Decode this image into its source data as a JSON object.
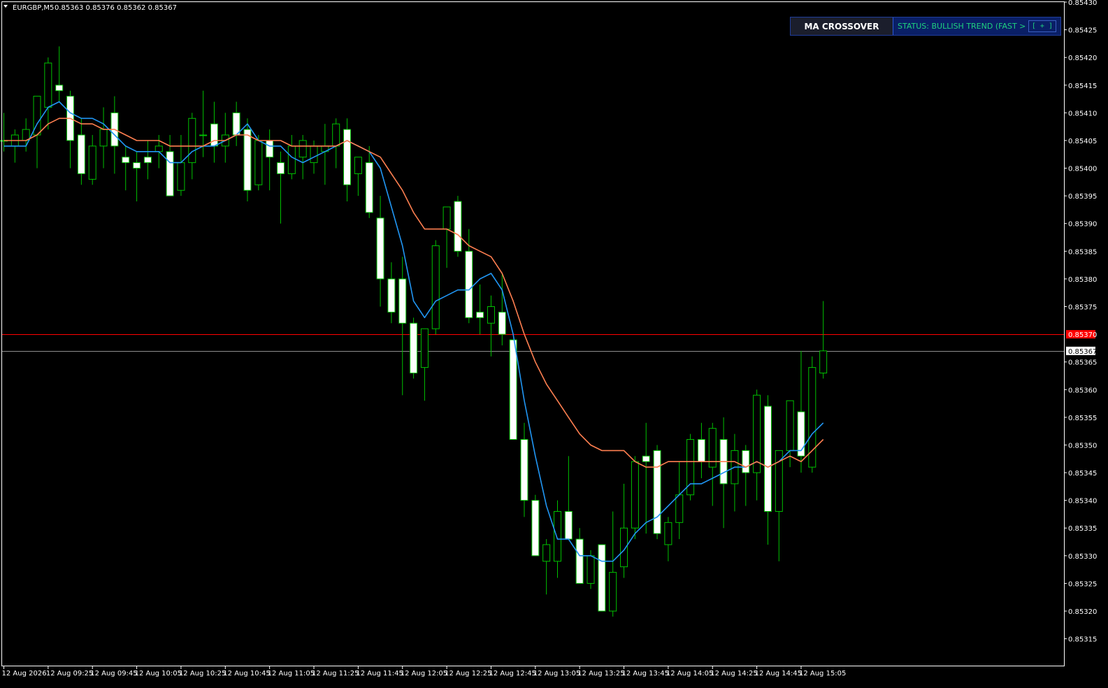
{
  "header": {
    "symbol": "EURGBP,M5",
    "ohlc": "0.85363 0.85376 0.85362 0.85367"
  },
  "panel": {
    "title": "MA CROSSOVER",
    "status": "STATUS: BULLISH TREND (FAST > SLOW)",
    "expand_label": "[ + ]"
  },
  "colors": {
    "background": "#000000",
    "candle_outline": "#00c000",
    "bull_body": "#000000",
    "bear_body": "#ffffff",
    "fast_ma": "#2196f3",
    "slow_ma": "#ff7f50",
    "alert_line": "#ff0000",
    "bid_line": "#8c8c8c",
    "price_scale_text": "#ffffff"
  },
  "chart_data": {
    "type": "candlestick",
    "symbol": "EURGBP",
    "timeframe": "M5",
    "ylim": [
      0.85312,
      0.8543
    ],
    "yticks": [
      "0.85430",
      "0.85425",
      "0.85420",
      "0.85415",
      "0.85410",
      "0.85405",
      "0.85400",
      "0.85395",
      "0.85390",
      "0.85385",
      "0.85380",
      "0.85375",
      "0.85365",
      "0.85360",
      "0.85355",
      "0.85350",
      "0.85345",
      "0.85340",
      "0.85335",
      "0.85330",
      "0.85325",
      "0.85320",
      "0.85315"
    ],
    "xticks": [
      {
        "index": 0,
        "label": "12 Aug 2026"
      },
      {
        "index": 4,
        "label": "12 Aug 09:25"
      },
      {
        "index": 8,
        "label": "12 Aug 09:45"
      },
      {
        "index": 12,
        "label": "12 Aug 10:05"
      },
      {
        "index": 16,
        "label": "12 Aug 10:25"
      },
      {
        "index": 20,
        "label": "12 Aug 10:45"
      },
      {
        "index": 24,
        "label": "12 Aug 11:05"
      },
      {
        "index": 28,
        "label": "12 Aug 11:25"
      },
      {
        "index": 32,
        "label": "12 Aug 11:45"
      },
      {
        "index": 36,
        "label": "12 Aug 12:05"
      },
      {
        "index": 40,
        "label": "12 Aug 12:25"
      },
      {
        "index": 44,
        "label": "12 Aug 12:45"
      },
      {
        "index": 48,
        "label": "12 Aug 13:05"
      },
      {
        "index": 52,
        "label": "12 Aug 13:25"
      },
      {
        "index": 56,
        "label": "12 Aug 13:45"
      },
      {
        "index": 60,
        "label": "12 Aug 14:05"
      },
      {
        "index": 64,
        "label": "12 Aug 14:25"
      },
      {
        "index": 68,
        "label": "12 Aug 14:45"
      },
      {
        "index": 72,
        "label": "12 Aug 15:05"
      }
    ],
    "candles": [
      {
        "o": 0.85405,
        "h": 0.8541,
        "l": 0.85403,
        "c": 0.85405
      },
      {
        "o": 0.85404,
        "h": 0.85407,
        "l": 0.85401,
        "c": 0.85406
      },
      {
        "o": 0.85405,
        "h": 0.85409,
        "l": 0.85403,
        "c": 0.85407
      },
      {
        "o": 0.85406,
        "h": 0.85413,
        "l": 0.854,
        "c": 0.85413
      },
      {
        "o": 0.85411,
        "h": 0.8542,
        "l": 0.85407,
        "c": 0.85419
      },
      {
        "o": 0.85415,
        "h": 0.85422,
        "l": 0.85412,
        "c": 0.85414
      },
      {
        "o": 0.85413,
        "h": 0.85414,
        "l": 0.854,
        "c": 0.85405
      },
      {
        "o": 0.85406,
        "h": 0.85409,
        "l": 0.85397,
        "c": 0.85399
      },
      {
        "o": 0.85398,
        "h": 0.85406,
        "l": 0.85397,
        "c": 0.85404
      },
      {
        "o": 0.85404,
        "h": 0.85411,
        "l": 0.854,
        "c": 0.85407
      },
      {
        "o": 0.8541,
        "h": 0.85413,
        "l": 0.85399,
        "c": 0.85404
      },
      {
        "o": 0.85402,
        "h": 0.85404,
        "l": 0.85396,
        "c": 0.85401
      },
      {
        "o": 0.85401,
        "h": 0.85403,
        "l": 0.85394,
        "c": 0.854
      },
      {
        "o": 0.85402,
        "h": 0.85405,
        "l": 0.85398,
        "c": 0.85401
      },
      {
        "o": 0.85403,
        "h": 0.85406,
        "l": 0.854,
        "c": 0.85404
      },
      {
        "o": 0.85403,
        "h": 0.85406,
        "l": 0.85395,
        "c": 0.85395
      },
      {
        "o": 0.85396,
        "h": 0.85406,
        "l": 0.85395,
        "c": 0.85401
      },
      {
        "o": 0.85401,
        "h": 0.8541,
        "l": 0.85398,
        "c": 0.85409
      },
      {
        "o": 0.85406,
        "h": 0.85414,
        "l": 0.85402,
        "c": 0.85406
      },
      {
        "o": 0.85408,
        "h": 0.85412,
        "l": 0.85401,
        "c": 0.85404
      },
      {
        "o": 0.85404,
        "h": 0.8541,
        "l": 0.85401,
        "c": 0.85406
      },
      {
        "o": 0.8541,
        "h": 0.85412,
        "l": 0.85404,
        "c": 0.85406
      },
      {
        "o": 0.85407,
        "h": 0.85409,
        "l": 0.85394,
        "c": 0.85396
      },
      {
        "o": 0.85397,
        "h": 0.85406,
        "l": 0.85396,
        "c": 0.85405
      },
      {
        "o": 0.85405,
        "h": 0.85407,
        "l": 0.85396,
        "c": 0.85402
      },
      {
        "o": 0.85401,
        "h": 0.85403,
        "l": 0.8539,
        "c": 0.85399
      },
      {
        "o": 0.85399,
        "h": 0.85406,
        "l": 0.85398,
        "c": 0.85404
      },
      {
        "o": 0.85402,
        "h": 0.85406,
        "l": 0.85398,
        "c": 0.85405
      },
      {
        "o": 0.85401,
        "h": 0.85405,
        "l": 0.85399,
        "c": 0.85404
      },
      {
        "o": 0.85403,
        "h": 0.85408,
        "l": 0.85397,
        "c": 0.85404
      },
      {
        "o": 0.85404,
        "h": 0.85409,
        "l": 0.854,
        "c": 0.85408
      },
      {
        "o": 0.85407,
        "h": 0.85409,
        "l": 0.85394,
        "c": 0.85397
      },
      {
        "o": 0.85399,
        "h": 0.85402,
        "l": 0.85395,
        "c": 0.85402
      },
      {
        "o": 0.85401,
        "h": 0.85404,
        "l": 0.85391,
        "c": 0.85392
      },
      {
        "o": 0.85391,
        "h": 0.85395,
        "l": 0.85375,
        "c": 0.8538
      },
      {
        "o": 0.8538,
        "h": 0.85383,
        "l": 0.85372,
        "c": 0.85374
      },
      {
        "o": 0.8538,
        "h": 0.85384,
        "l": 0.85359,
        "c": 0.85372
      },
      {
        "o": 0.85372,
        "h": 0.85373,
        "l": 0.85362,
        "c": 0.85363
      },
      {
        "o": 0.85364,
        "h": 0.85371,
        "l": 0.85358,
        "c": 0.85371
      },
      {
        "o": 0.85371,
        "h": 0.85387,
        "l": 0.8537,
        "c": 0.85386
      },
      {
        "o": 0.85389,
        "h": 0.85393,
        "l": 0.85382,
        "c": 0.85393
      },
      {
        "o": 0.85394,
        "h": 0.85395,
        "l": 0.85384,
        "c": 0.85385
      },
      {
        "o": 0.85385,
        "h": 0.85389,
        "l": 0.85372,
        "c": 0.85373
      },
      {
        "o": 0.85374,
        "h": 0.85379,
        "l": 0.8537,
        "c": 0.85373
      },
      {
        "o": 0.85372,
        "h": 0.85377,
        "l": 0.85366,
        "c": 0.85375
      },
      {
        "o": 0.85374,
        "h": 0.85381,
        "l": 0.85368,
        "c": 0.8537
      },
      {
        "o": 0.85369,
        "h": 0.85369,
        "l": 0.85351,
        "c": 0.85351
      },
      {
        "o": 0.85351,
        "h": 0.85354,
        "l": 0.85337,
        "c": 0.8534
      },
      {
        "o": 0.8534,
        "h": 0.85341,
        "l": 0.8533,
        "c": 0.8533
      },
      {
        "o": 0.85329,
        "h": 0.85333,
        "l": 0.85323,
        "c": 0.85332
      },
      {
        "o": 0.85329,
        "h": 0.8534,
        "l": 0.85326,
        "c": 0.85338
      },
      {
        "o": 0.85338,
        "h": 0.85348,
        "l": 0.85333,
        "c": 0.85333
      },
      {
        "o": 0.85333,
        "h": 0.85335,
        "l": 0.85325,
        "c": 0.85325
      },
      {
        "o": 0.85325,
        "h": 0.85331,
        "l": 0.85324,
        "c": 0.8533
      },
      {
        "o": 0.85332,
        "h": 0.85332,
        "l": 0.8532,
        "c": 0.8532
      },
      {
        "o": 0.8532,
        "h": 0.85338,
        "l": 0.85319,
        "c": 0.85327
      },
      {
        "o": 0.85328,
        "h": 0.85343,
        "l": 0.85326,
        "c": 0.85335
      },
      {
        "o": 0.85335,
        "h": 0.85348,
        "l": 0.85333,
        "c": 0.85347
      },
      {
        "o": 0.85348,
        "h": 0.85354,
        "l": 0.85334,
        "c": 0.85347
      },
      {
        "o": 0.85349,
        "h": 0.8535,
        "l": 0.85333,
        "c": 0.85334
      },
      {
        "o": 0.85332,
        "h": 0.85337,
        "l": 0.85329,
        "c": 0.85336
      },
      {
        "o": 0.85336,
        "h": 0.85347,
        "l": 0.85333,
        "c": 0.85341
      },
      {
        "o": 0.85341,
        "h": 0.85352,
        "l": 0.8534,
        "c": 0.85351
      },
      {
        "o": 0.85351,
        "h": 0.85354,
        "l": 0.85344,
        "c": 0.85347
      },
      {
        "o": 0.85346,
        "h": 0.85354,
        "l": 0.85339,
        "c": 0.85353
      },
      {
        "o": 0.85351,
        "h": 0.85355,
        "l": 0.85335,
        "c": 0.85343
      },
      {
        "o": 0.85343,
        "h": 0.85352,
        "l": 0.85338,
        "c": 0.85349
      },
      {
        "o": 0.85349,
        "h": 0.8535,
        "l": 0.85339,
        "c": 0.85345
      },
      {
        "o": 0.85345,
        "h": 0.8536,
        "l": 0.8534,
        "c": 0.85359
      },
      {
        "o": 0.85357,
        "h": 0.85359,
        "l": 0.85332,
        "c": 0.85338
      },
      {
        "o": 0.85338,
        "h": 0.85348,
        "l": 0.85329,
        "c": 0.85349
      },
      {
        "o": 0.85349,
        "h": 0.85358,
        "l": 0.85346,
        "c": 0.85358
      },
      {
        "o": 0.85356,
        "h": 0.85367,
        "l": 0.85345,
        "c": 0.85348
      },
      {
        "o": 0.85346,
        "h": 0.85366,
        "l": 0.85345,
        "c": 0.85364
      },
      {
        "o": 0.85363,
        "h": 0.85376,
        "l": 0.85362,
        "c": 0.85367
      }
    ],
    "series": [
      {
        "name": "",
        "color": "#2196f3",
        "values": [
          0.85404,
          0.85404,
          0.85404,
          0.85408,
          0.85411,
          0.85412,
          0.8541,
          0.85409,
          0.85409,
          0.85408,
          0.85406,
          0.85404,
          0.85403,
          0.85403,
          0.85403,
          0.85401,
          0.85401,
          0.85403,
          0.85404,
          0.85404,
          0.85405,
          0.85406,
          0.85408,
          0.85405,
          0.85404,
          0.85404,
          0.85402,
          0.85401,
          0.85402,
          0.85403,
          0.85404,
          0.85405,
          0.85404,
          0.85403,
          0.854,
          0.85393,
          0.85386,
          0.85376,
          0.85373,
          0.85376,
          0.85377,
          0.85378,
          0.85378,
          0.8538,
          0.85381,
          0.85378,
          0.8537,
          0.85358,
          0.85348,
          0.85339,
          0.85333,
          0.85333,
          0.8533,
          0.8533,
          0.85329,
          0.85329,
          0.85331,
          0.85334,
          0.85336,
          0.85337,
          0.85339,
          0.85341,
          0.85343,
          0.85343,
          0.85344,
          0.85345,
          0.85346,
          0.85346,
          0.85347,
          0.85346,
          0.85347,
          0.85349,
          0.85349,
          0.85352,
          0.85354
        ]
      },
      {
        "name": "",
        "color": "#ff7f50",
        "values": [
          0.85405,
          0.85405,
          0.85405,
          0.85406,
          0.85408,
          0.85409,
          0.85409,
          0.85408,
          0.85408,
          0.85407,
          0.85407,
          0.85406,
          0.85405,
          0.85405,
          0.85405,
          0.85404,
          0.85404,
          0.85404,
          0.85404,
          0.85405,
          0.85405,
          0.85406,
          0.85406,
          0.85405,
          0.85405,
          0.85405,
          0.85404,
          0.85404,
          0.85404,
          0.85404,
          0.85404,
          0.85405,
          0.85404,
          0.85403,
          0.85402,
          0.85399,
          0.85396,
          0.85392,
          0.85389,
          0.85389,
          0.85389,
          0.85388,
          0.85386,
          0.85385,
          0.85384,
          0.85381,
          0.85376,
          0.8537,
          0.85365,
          0.85361,
          0.85358,
          0.85355,
          0.85352,
          0.8535,
          0.85349,
          0.85349,
          0.85349,
          0.85347,
          0.85346,
          0.85346,
          0.85347,
          0.85347,
          0.85347,
          0.85347,
          0.85347,
          0.85347,
          0.85347,
          0.85346,
          0.85347,
          0.85346,
          0.85347,
          0.85348,
          0.85347,
          0.85349,
          0.85351
        ]
      }
    ],
    "hlines": [
      {
        "value": 0.8537,
        "color": "#ff0000",
        "label": "0.85370"
      },
      {
        "value": 0.85367,
        "color": "#8c8c8c",
        "label": "0.85367"
      }
    ]
  }
}
